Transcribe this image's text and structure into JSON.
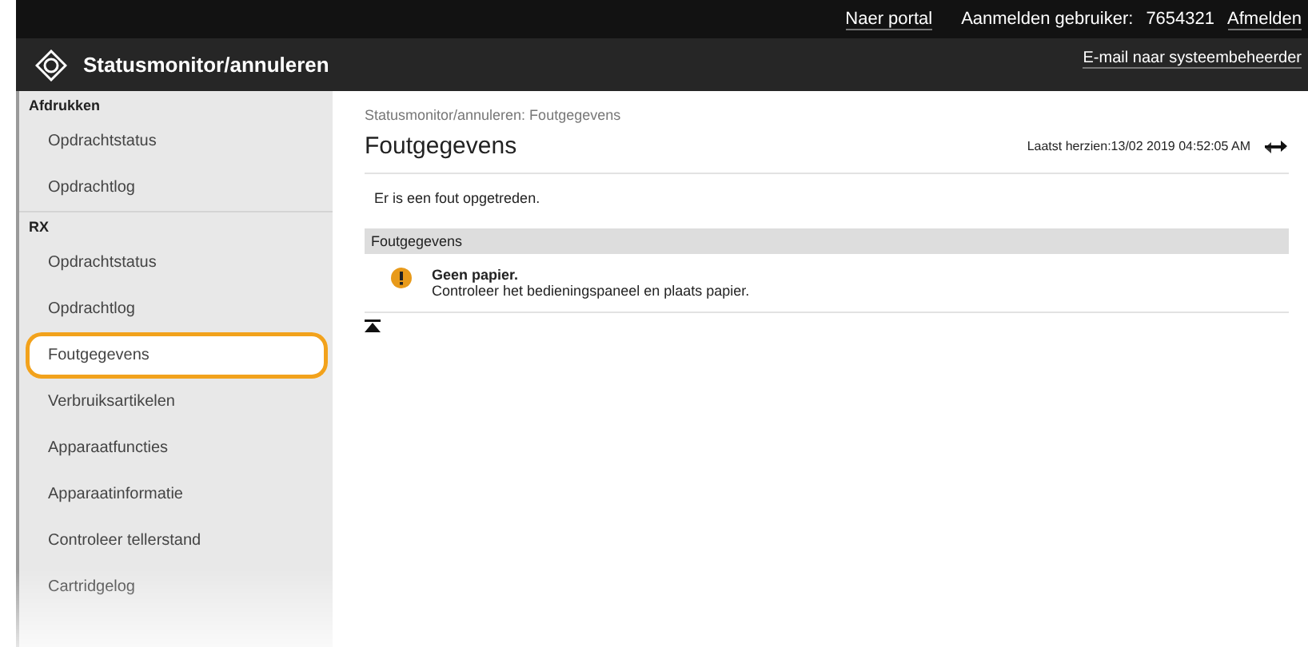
{
  "top_bar": {
    "links": [
      "Naer portal"
    ],
    "user_label": "Aanmelden gebruiker:",
    "user_id": "7654321",
    "logout": "Afmelden"
  },
  "header": {
    "title": "Statusmonitor/annuleren",
    "email_link": "E-mail naar systeembeheerder"
  },
  "sidebar": {
    "sections": [
      {
        "heading": "Afdrukken",
        "items": [
          {
            "label": "Opdrachtstatus",
            "selected": false
          },
          {
            "label": "Opdrachtlog",
            "selected": false
          }
        ]
      },
      {
        "heading": "RX",
        "items": [
          {
            "label": "Opdrachtstatus",
            "selected": false
          },
          {
            "label": "Opdrachtlog",
            "selected": false
          },
          {
            "label": "Foutgegevens",
            "selected": true
          },
          {
            "label": "Verbruiksartikelen",
            "selected": false
          },
          {
            "label": "Apparaatfuncties",
            "selected": false
          },
          {
            "label": "Apparaatinformatie",
            "selected": false
          },
          {
            "label": "Controleer tellerstand",
            "selected": false
          },
          {
            "label": "Cartridgelog",
            "selected": false
          }
        ]
      }
    ]
  },
  "main": {
    "breadcrumb": "Statusmonitor/annuleren: Foutgegevens",
    "title": "Foutgegevens",
    "last_updated": "Laatst herzien:13/02 2019 04:52:05 AM",
    "message": "Er is een fout opgetreden.",
    "section": {
      "heading": "Foutgegevens",
      "errors": [
        {
          "title": "Geen papier.",
          "detail": "Controleer het bedieningspaneel en plaats papier."
        }
      ]
    }
  }
}
